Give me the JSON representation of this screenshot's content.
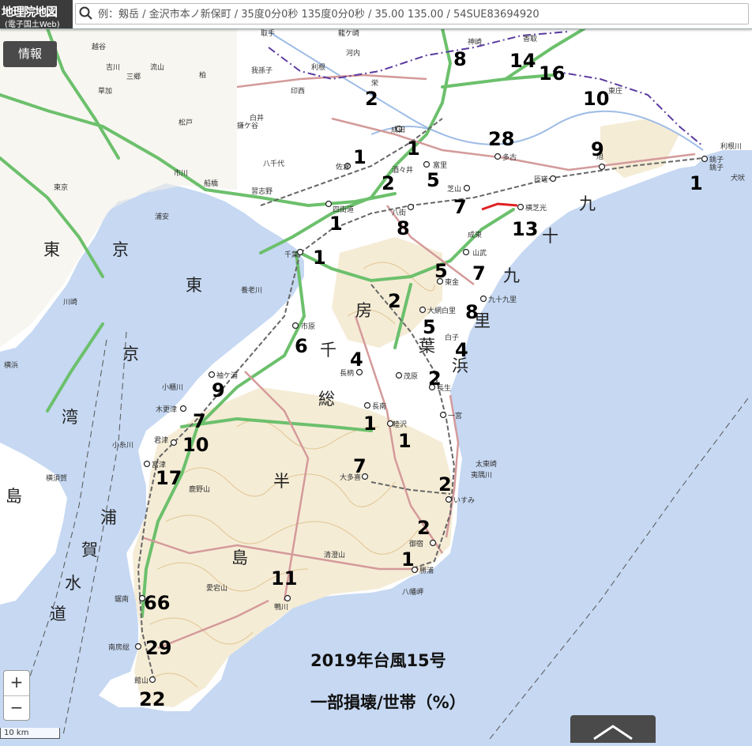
{
  "app": {
    "logo_main": "地理院地図",
    "logo_sub": "(電子国土Web)"
  },
  "search": {
    "placeholder": "例：剱岳 / 金沢市本ノ新保町 / 35度0分0秒 135度0分0秒 / 35.00 135.00 / 54SUE83694920"
  },
  "controls": {
    "info_label": "情報",
    "zoom_in": "+",
    "zoom_out": "−",
    "scale_label": "10 km"
  },
  "legend": {
    "line1": "2019年台風15号",
    "line2": "一部損壊/世帯（%）"
  },
  "colors": {
    "sea": "#c6d8f2",
    "land": "#ffffff",
    "hills": "#f5ecd6",
    "expressway": "#6cc06c",
    "national_road": "#d49a9a",
    "railway": "#777777",
    "number_text": "#000000"
  },
  "big_labels": [
    "東",
    "京",
    "東",
    "京",
    "湾",
    "房",
    "千",
    "葉",
    "総",
    "半",
    "島",
    "浦",
    "賀",
    "水",
    "道",
    "九",
    "十",
    "九",
    "里",
    "浜",
    "島"
  ],
  "place_names": [
    "成田",
    "富里",
    "多古",
    "匝瑳",
    "旭",
    "銚子",
    "八街",
    "芝山",
    "横芝光",
    "山武",
    "東金",
    "大網白里",
    "九十九里",
    "白子",
    "茂原",
    "長生",
    "長柄",
    "市原",
    "袖ケ浦",
    "木更津",
    "君津",
    "富津",
    "長南",
    "睦沢",
    "一宮",
    "大多喜",
    "いすみ",
    "御宿",
    "勝浦",
    "鴨川",
    "鋸南",
    "南房総",
    "館山",
    "佐倉",
    "四街道",
    "酒々井",
    "印西",
    "栄",
    "香取",
    "神崎",
    "東庄",
    "船橋",
    "市川",
    "浦安",
    "習志野",
    "八千代",
    "鎌ケ谷",
    "白井",
    "我孫子",
    "柏",
    "流山",
    "吉川",
    "草加",
    "松戸",
    "越谷",
    "三郷",
    "川崎",
    "横浜",
    "横須賀",
    "利根川",
    "太東崎",
    "夷隅川",
    "養老川",
    "小櫃川",
    "小糸川",
    "鹿野山",
    "愛宕山",
    "清澄山",
    "八幡岬",
    "犬吠",
    "東京",
    "千葉",
    "銚子",
    "取手",
    "龍ケ崎",
    "河内",
    "利根",
    "成東"
  ],
  "damage_values": [
    "8",
    "14",
    "16",
    "2",
    "10",
    "28",
    "1",
    "1",
    "5",
    "9",
    "2",
    "1",
    "7",
    "1",
    "8",
    "13",
    "1",
    "5",
    "7",
    "2",
    "8",
    "5",
    "6",
    "4",
    "4",
    "2",
    "9",
    "1",
    "7",
    "1",
    "10",
    "17",
    "7",
    "2",
    "2",
    "1",
    "11",
    "66",
    "29",
    "22"
  ]
}
